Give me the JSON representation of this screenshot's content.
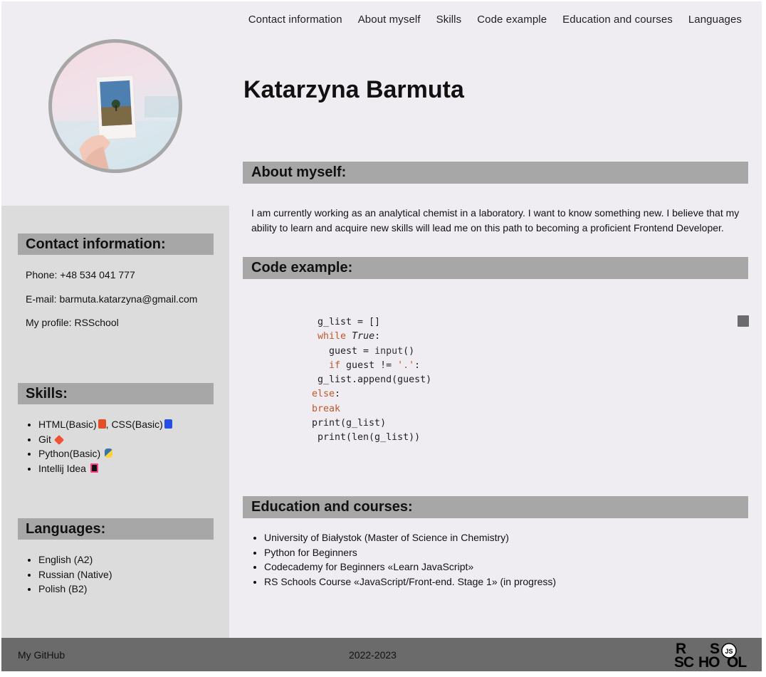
{
  "nav": [
    "Contact information",
    "About myself",
    "Skills",
    "Code example",
    "Education and courses",
    "Languages"
  ],
  "name": "Katarzyna Barmuta",
  "sidebar": {
    "contact": {
      "heading": "Contact information:",
      "phone": "Phone: +48 534 041 777",
      "email": "E-mail: barmuta.katarzyna@gmail.com",
      "profile": "My profile: RSSchool"
    },
    "skills": {
      "heading": "Skills:",
      "items": [
        {
          "label": "HTML(Basic)",
          "icon": "html5-icon",
          "color": "#e44d26"
        },
        {
          "label": ", CSS(Basic)",
          "icon": "css3-icon",
          "color": "#264de4"
        },
        {
          "label": "Git",
          "icon": "git-icon",
          "color": "#f05033"
        },
        {
          "label": "Python(Basic)",
          "icon": "python-icon",
          "color": "#ffd43b"
        },
        {
          "label": "Intellij Idea",
          "icon": "intellij-icon",
          "color": "#2b2b7a"
        }
      ]
    },
    "languages": {
      "heading": "Languages:",
      "items": [
        "English (A2)",
        "Russian (Native)",
        "Polish (B2)"
      ]
    }
  },
  "about": {
    "heading": "About myself:",
    "text": "I am currently working as an analytical chemist in a laboratory. I want to know something new. I believe that my ability to learn and acquire new skills will lead me on this path to becoming a proficient Frontend Developer."
  },
  "code": {
    "heading": "Code example:",
    "lines": [
      " g_list = []",
      " while True:",
      "   guest = input()",
      "   if guest != '.':",
      " g_list.append(guest)",
      "else:",
      "break",
      "print(g_list)",
      " print(len(g_list))"
    ]
  },
  "education": {
    "heading": "Education and courses:",
    "items": [
      "University of Białystok (Master of Science in Chemistry)",
      "Python for Beginners",
      "Codecademy for Beginners «Learn JavaScript»",
      "RS Schools Course «JavaScript/Front-end. Stage 1» (in progress)"
    ]
  },
  "footer": {
    "github": "My GitHub",
    "years": "2022-2023",
    "logo_text": "RS SCHOOL JS"
  },
  "colors": {
    "background": "#efedf2",
    "sidebar": "#dcdcdc",
    "heading_bar": "#a7a7a7",
    "footer": "#6b6b6b",
    "code_keyword": "#c0582a"
  }
}
